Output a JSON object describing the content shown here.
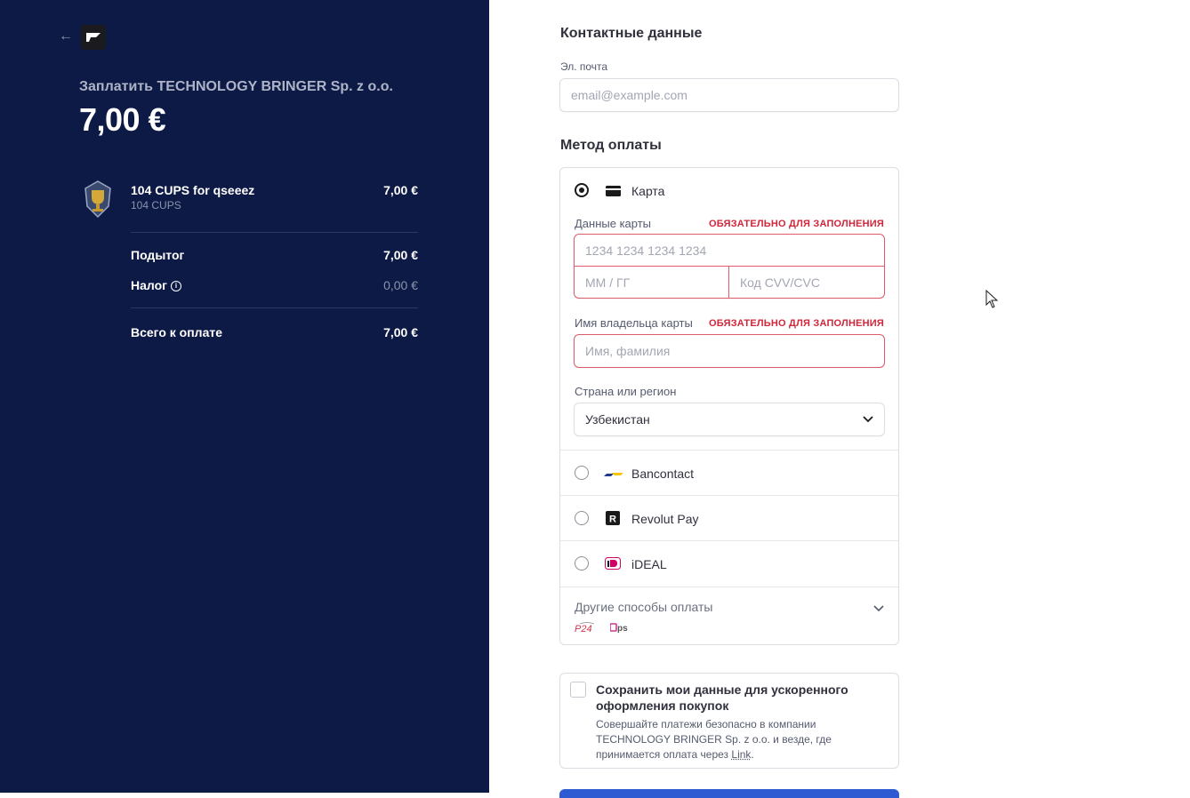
{
  "order": {
    "merchant_line": "Заплатить TECHNOLOGY BRINGER Sp. z o.o.",
    "total_big": "7,00 €",
    "product": {
      "name": "104 CUPS for qseeez",
      "subtitle": "104 CUPS",
      "price": "7,00 €"
    },
    "subtotal_label": "Подытог",
    "subtotal_value": "7,00 €",
    "tax_label": "Налог",
    "tax_value": "0,00 €",
    "total_label": "Всего к оплате",
    "total_value": "7,00 €"
  },
  "contact": {
    "heading": "Контактные данные",
    "email_label": "Эл. почта",
    "email_placeholder": "email@example.com"
  },
  "payment": {
    "heading": "Метод оплаты",
    "card_label": "Карта",
    "card_data_label": "Данные карты",
    "required_text": "ОБЯЗАТЕЛЬНО ДЛЯ ЗАПОЛНЕНИЯ",
    "card_number_placeholder": "1234 1234 1234 1234",
    "expiry_placeholder": "ММ / ГГ",
    "cvc_placeholder": "Код CVV/CVC",
    "holder_label": "Имя владельца карты",
    "holder_placeholder": "Имя, фамилия",
    "country_label": "Страна или регион",
    "country_value": "Узбекистан",
    "methods": [
      {
        "label": "Bancontact",
        "icon": "bancontact-icon"
      },
      {
        "label": "Revolut Pay",
        "icon": "revolut-icon"
      },
      {
        "label": "iDEAL",
        "icon": "ideal-icon"
      }
    ],
    "other_label": "Другие способы оплаты",
    "other_icons": [
      "p24-icon",
      "eps-icon"
    ]
  },
  "save": {
    "title": "Сохранить мои данные для ускоренного оформления покупок",
    "text": "Совершайте платежи безопасно в компании TECHNOLOGY BRINGER Sp. z o.o. и везде, где принимается оплата через",
    "link": "Link",
    "period": "."
  },
  "colors": {
    "left_bg": "#0d1a45",
    "required": "#d0273a",
    "button": "#2f5bd2"
  }
}
